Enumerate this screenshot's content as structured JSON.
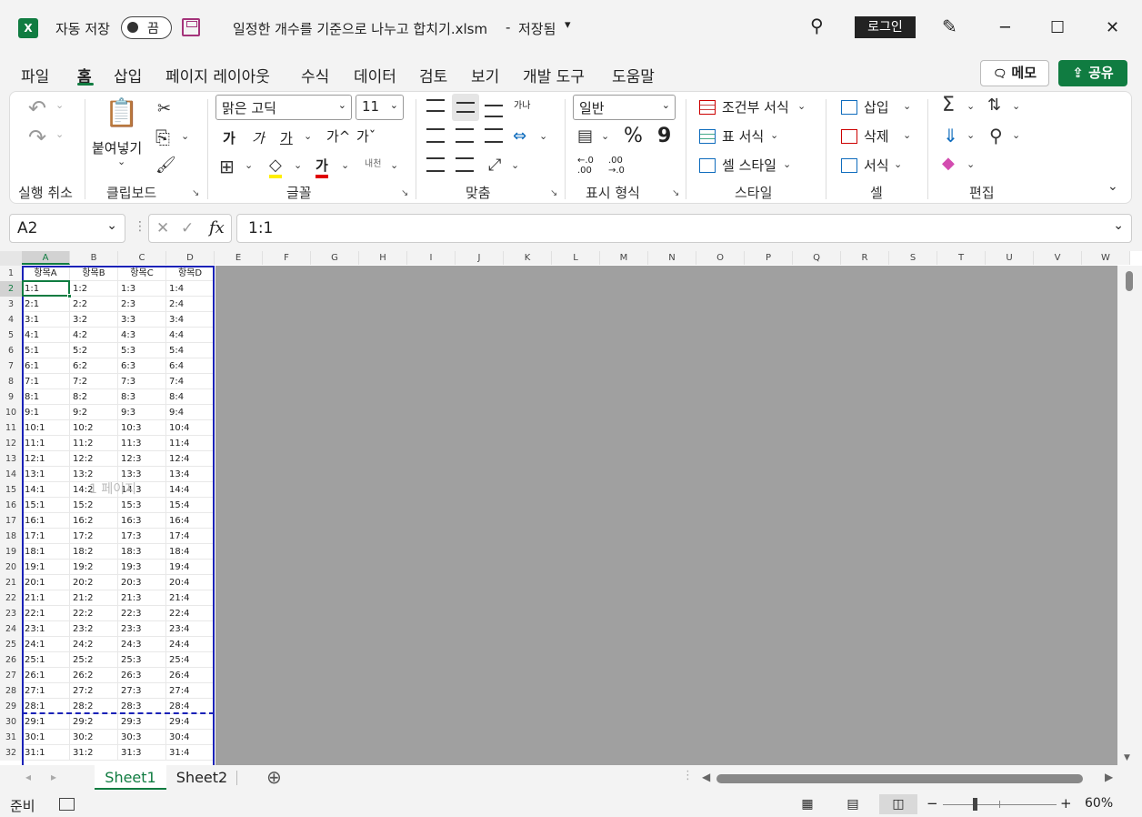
{
  "titlebar": {
    "app_icon": "excel-icon",
    "autosave_label": "자동 저장",
    "autosave_state": "끔",
    "filename": "일정한 개수를 기준으로 나누고 합치기.xlsm",
    "separator": "-",
    "save_status": "저장됨",
    "dropdown_glyph": "▾",
    "login_label": "로그인",
    "search_glyph": "⚲",
    "pen_glyph": "✎",
    "minimize_glyph": "─",
    "maximize_glyph": "☐",
    "close_glyph": "✕"
  },
  "tabs": [
    "파일",
    "홈",
    "삽입",
    "페이지 레이아웃",
    "수식",
    "데이터",
    "검토",
    "보기",
    "개발 도구",
    "도움말"
  ],
  "active_tab": "홈",
  "header_buttons": {
    "memo": "메모",
    "share": "공유",
    "memo_glyph": "🗨",
    "share_glyph": "⇪"
  },
  "ribbon": {
    "undo": {
      "undo_glyph": "↶",
      "redo_glyph": "↷",
      "label": "실행 취소",
      "caret": "⌄"
    },
    "clipboard": {
      "paste_label": "붙여넣기",
      "paste_glyph": "📋",
      "cut_glyph": "✂",
      "copy_glyph": "⎘",
      "format_painter_glyph": "🖌",
      "label": "클립보드",
      "caret": "⌄"
    },
    "font": {
      "font_name": "맑은 고딕",
      "font_size": "11",
      "bold": "가",
      "italic": "가",
      "underline": "가",
      "grow": "가^",
      "shrink": "가ˇ",
      "border_glyph": "⊞",
      "fill_glyph": "◇",
      "font_color_glyph": "가",
      "phonetic_glyph": "내천",
      "label": "글꼴",
      "caret": "⌄"
    },
    "alignment": {
      "label": "맞춤",
      "wrap_glyph": "가나",
      "merge_glyph": "⇔",
      "orient_glyph": "⤢",
      "caret": "⌄"
    },
    "number": {
      "format": "일반",
      "percent": "%",
      "comma": "9",
      "accounting_glyph": "▤",
      "inc_decimal": "←.0 .00",
      "dec_decimal": ".00 →.0",
      "label": "표시 형식",
      "caret": "⌄"
    },
    "styles": {
      "conditional": "조건부 서식",
      "table_format": "표 서식",
      "cell_style": "셀 스타일",
      "label": "스타일",
      "caret": "⌄"
    },
    "cells": {
      "insert": "삽입",
      "delete": "삭제",
      "format": "서식",
      "label": "셀",
      "caret": "⌄"
    },
    "editing": {
      "sum_glyph": "Σ",
      "sort_glyph": "⇅",
      "find_glyph": "⚲",
      "fill_glyph": "⇓",
      "clear_glyph": "◆",
      "label": "편집",
      "caret": "⌄"
    },
    "launcher_glyph": "↘",
    "collapse_glyph": "⌄"
  },
  "formula_bar": {
    "name_box": "A2",
    "name_caret": "⌄",
    "cancel_glyph": "✕",
    "enter_glyph": "✓",
    "fx": "fx",
    "value": "1:1",
    "expand_caret": "⌄"
  },
  "grid": {
    "columns": [
      "A",
      "B",
      "C",
      "D",
      "E",
      "F",
      "G",
      "H",
      "I",
      "J",
      "K",
      "L",
      "M",
      "N",
      "O",
      "P",
      "Q",
      "R",
      "S",
      "T",
      "U",
      "V",
      "W"
    ],
    "header_row": [
      "항목A",
      "항목B",
      "항목C",
      "항목D"
    ],
    "row_count": 32,
    "watermark": "1 페이지"
  },
  "sheets": [
    "Sheet1",
    "Sheet2"
  ],
  "active_sheet": "Sheet1",
  "sheet_nav": {
    "prev": "◂",
    "next": "▸",
    "add": "⊕"
  },
  "status": {
    "mode": "준비",
    "zoom": "60%",
    "minus": "−",
    "plus": "+"
  }
}
